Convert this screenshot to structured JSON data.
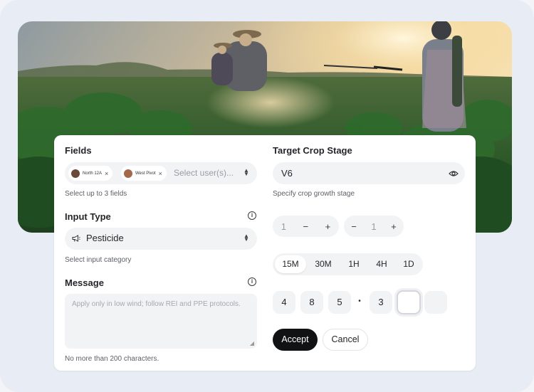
{
  "fields": {
    "label": "Fields",
    "chips": [
      {
        "label": "North 12A"
      },
      {
        "label": "West Pivot"
      }
    ],
    "placeholder": "Select user(s)...",
    "hint": "Select up to 3 fields"
  },
  "input_type": {
    "label": "Input Type",
    "value": "Pesticide",
    "hint": "Select input category"
  },
  "message": {
    "label": "Message",
    "placeholder": "Apply only in low wind; follow REI and PPE protocols.",
    "hint": "No more than 200 characters."
  },
  "target_crop_stage": {
    "label": "Target Crop Stage",
    "value": "V6",
    "hint": "Specify crop growth stage"
  },
  "steppers": [
    {
      "value": "1",
      "minus": "−",
      "plus": "+"
    },
    {
      "value": "1",
      "minus": "−",
      "plus": "+"
    }
  ],
  "intervals": {
    "options": [
      "15M",
      "30M",
      "1H",
      "4H",
      "1D"
    ],
    "selected": "15M"
  },
  "code": {
    "digits": [
      "4",
      "8",
      "5",
      "3",
      "",
      ""
    ],
    "separator": "•"
  },
  "actions": {
    "accept": "Accept",
    "cancel": "Cancel"
  },
  "colors": {
    "primary_button": "#111214",
    "field_bg": "#f2f3f5",
    "frame_bg": "#e8ecf5"
  },
  "icons": {
    "chevron_updown": "chevron-up-down-icon",
    "info": "info-icon",
    "eye": "eye-icon",
    "megaphone": "megaphone-icon",
    "close": "close-icon"
  }
}
